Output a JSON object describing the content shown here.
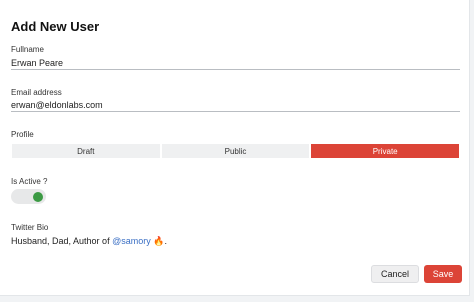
{
  "form": {
    "title": "Add New User",
    "fullname": {
      "label": "Fullname",
      "value": "Erwan Peare"
    },
    "email": {
      "label": "Email address",
      "value": "erwan@eldonlabs.com"
    },
    "profile": {
      "label": "Profile",
      "options": [
        "Draft",
        "Public",
        "Private"
      ],
      "selected": "Private"
    },
    "active": {
      "label": "Is Active ?",
      "on": true
    },
    "bio": {
      "label": "Twitter Bio",
      "text_before": "Husband, Dad, Author of ",
      "mention": "@samory",
      "emoji": "🔥",
      "text_after": "."
    },
    "actions": {
      "cancel_label": "Cancel",
      "save_label": "Save"
    }
  },
  "colors": {
    "accent": "#dc4437",
    "toggle_on": "#3c9a44",
    "mention": "#3a6fc4"
  }
}
